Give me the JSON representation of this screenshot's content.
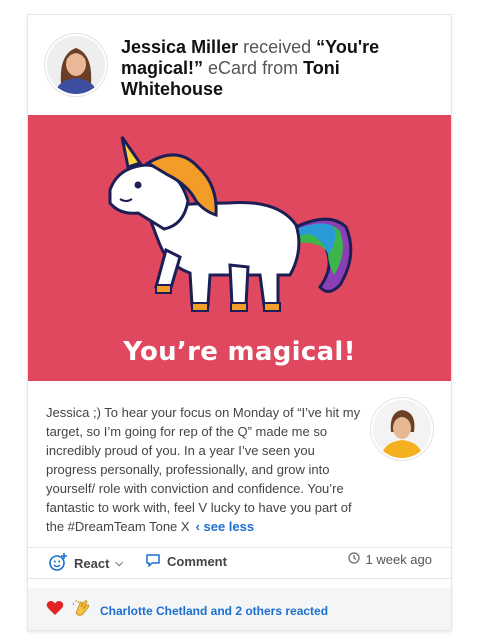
{
  "post": {
    "recipient": "Jessica Miller",
    "verb": "received",
    "ecard_name": "“You're magical!”",
    "mid": "eCard from",
    "sender": "Toni Whitehouse"
  },
  "ecard": {
    "caption": "You’re magical!",
    "background_color": "#e0485f"
  },
  "message": {
    "text": "Jessica ;) To hear your focus on Monday of “I’ve hit my target, so I’m going for rep of the Q” made me so incredibly proud of you. In a year I’ve seen you progress personally, professionally, and grow into yourself/ role with conviction and confidence. You’re fantastic to work with, feel V lucky to have you part of the #DreamTeam Tone X",
    "see_less": "‹ see less"
  },
  "actions": {
    "react_label": "React",
    "comment_label": "Comment",
    "timestamp": "1 week ago"
  },
  "reactions": {
    "summary": "Charlotte Chetland and 2 others reacted",
    "icons": [
      "heart-icon",
      "clapping-hands-icon"
    ]
  },
  "colors": {
    "link": "#1c6fd1",
    "banner": "#e0485f"
  }
}
